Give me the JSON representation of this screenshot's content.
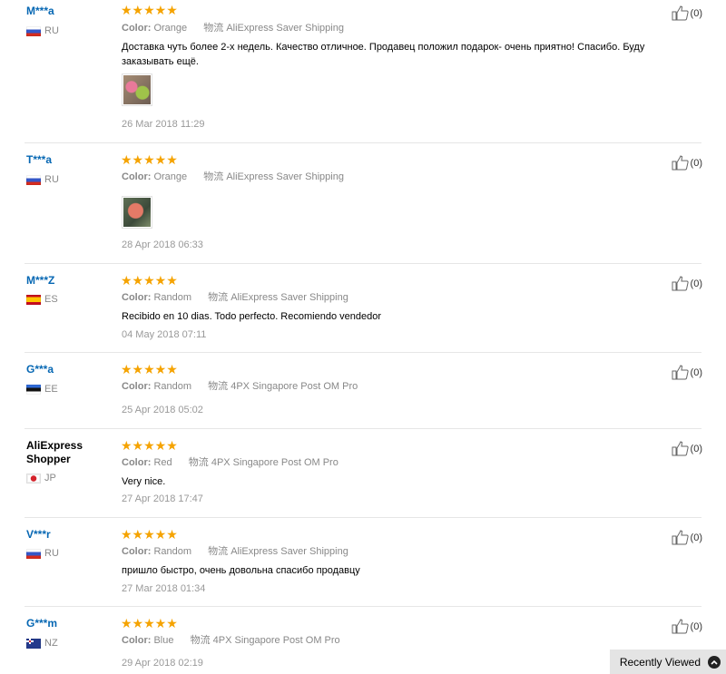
{
  "reviews": [
    {
      "user": "M***a",
      "country": "RU",
      "stars": "★★★★★",
      "color_label": "Color:",
      "color_value": "Orange",
      "shipping": "物流 AliExpress Saver Shipping",
      "text": "Доставка чуть более 2-х недель. Качество отличное. Продавец положил подарок- очень приятно! Спасибо. Буду заказывать ещё.",
      "date": "26 Mar 2018 11:29",
      "likes": "(0)"
    },
    {
      "user": "T***a",
      "country": "RU",
      "stars": "★★★★★",
      "color_label": "Color:",
      "color_value": "Orange",
      "shipping": "物流 AliExpress Saver Shipping",
      "date": "28 Apr 2018 06:33",
      "likes": "(0)"
    },
    {
      "user": "M***Z",
      "country": "ES",
      "stars": "★★★★★",
      "color_label": "Color:",
      "color_value": "Random",
      "shipping": "物流 AliExpress Saver Shipping",
      "text": "Recibido en 10 dias. Todo perfecto. Recomiendo vendedor",
      "date": "04 May 2018 07:11",
      "likes": "(0)"
    },
    {
      "user": "G***a",
      "country": "EE",
      "stars": "★★★★★",
      "color_label": "Color:",
      "color_value": "Random",
      "shipping": "物流 4PX Singapore Post OM Pro",
      "date": "25 Apr 2018 05:02",
      "likes": "(0)"
    },
    {
      "user": "AliExpress Shopper",
      "country": "JP",
      "stars": "★★★★★",
      "color_label": "Color:",
      "color_value": "Red",
      "shipping": "物流 4PX Singapore Post OM Pro",
      "text": "Very nice.",
      "date": "27 Apr 2018 17:47",
      "likes": "(0)"
    },
    {
      "user": "V***r",
      "country": "RU",
      "stars": "★★★★★",
      "color_label": "Color:",
      "color_value": "Random",
      "shipping": "物流 AliExpress Saver Shipping",
      "text": "пришло быстро, очень довольна спасибо продавцу",
      "date": "27 Mar 2018 01:34",
      "likes": "(0)"
    },
    {
      "user": "G***m",
      "country": "NZ",
      "stars": "★★★★★",
      "color_label": "Color:",
      "color_value": "Blue",
      "shipping": "物流 4PX Singapore Post OM Pro",
      "date": "29 Apr 2018 02:19",
      "likes": "(0)"
    }
  ],
  "recently_viewed": "Recently Viewed",
  "colors": {
    "username": "#0667b3",
    "stars": "#f5a300",
    "meta_text": "#888888"
  }
}
